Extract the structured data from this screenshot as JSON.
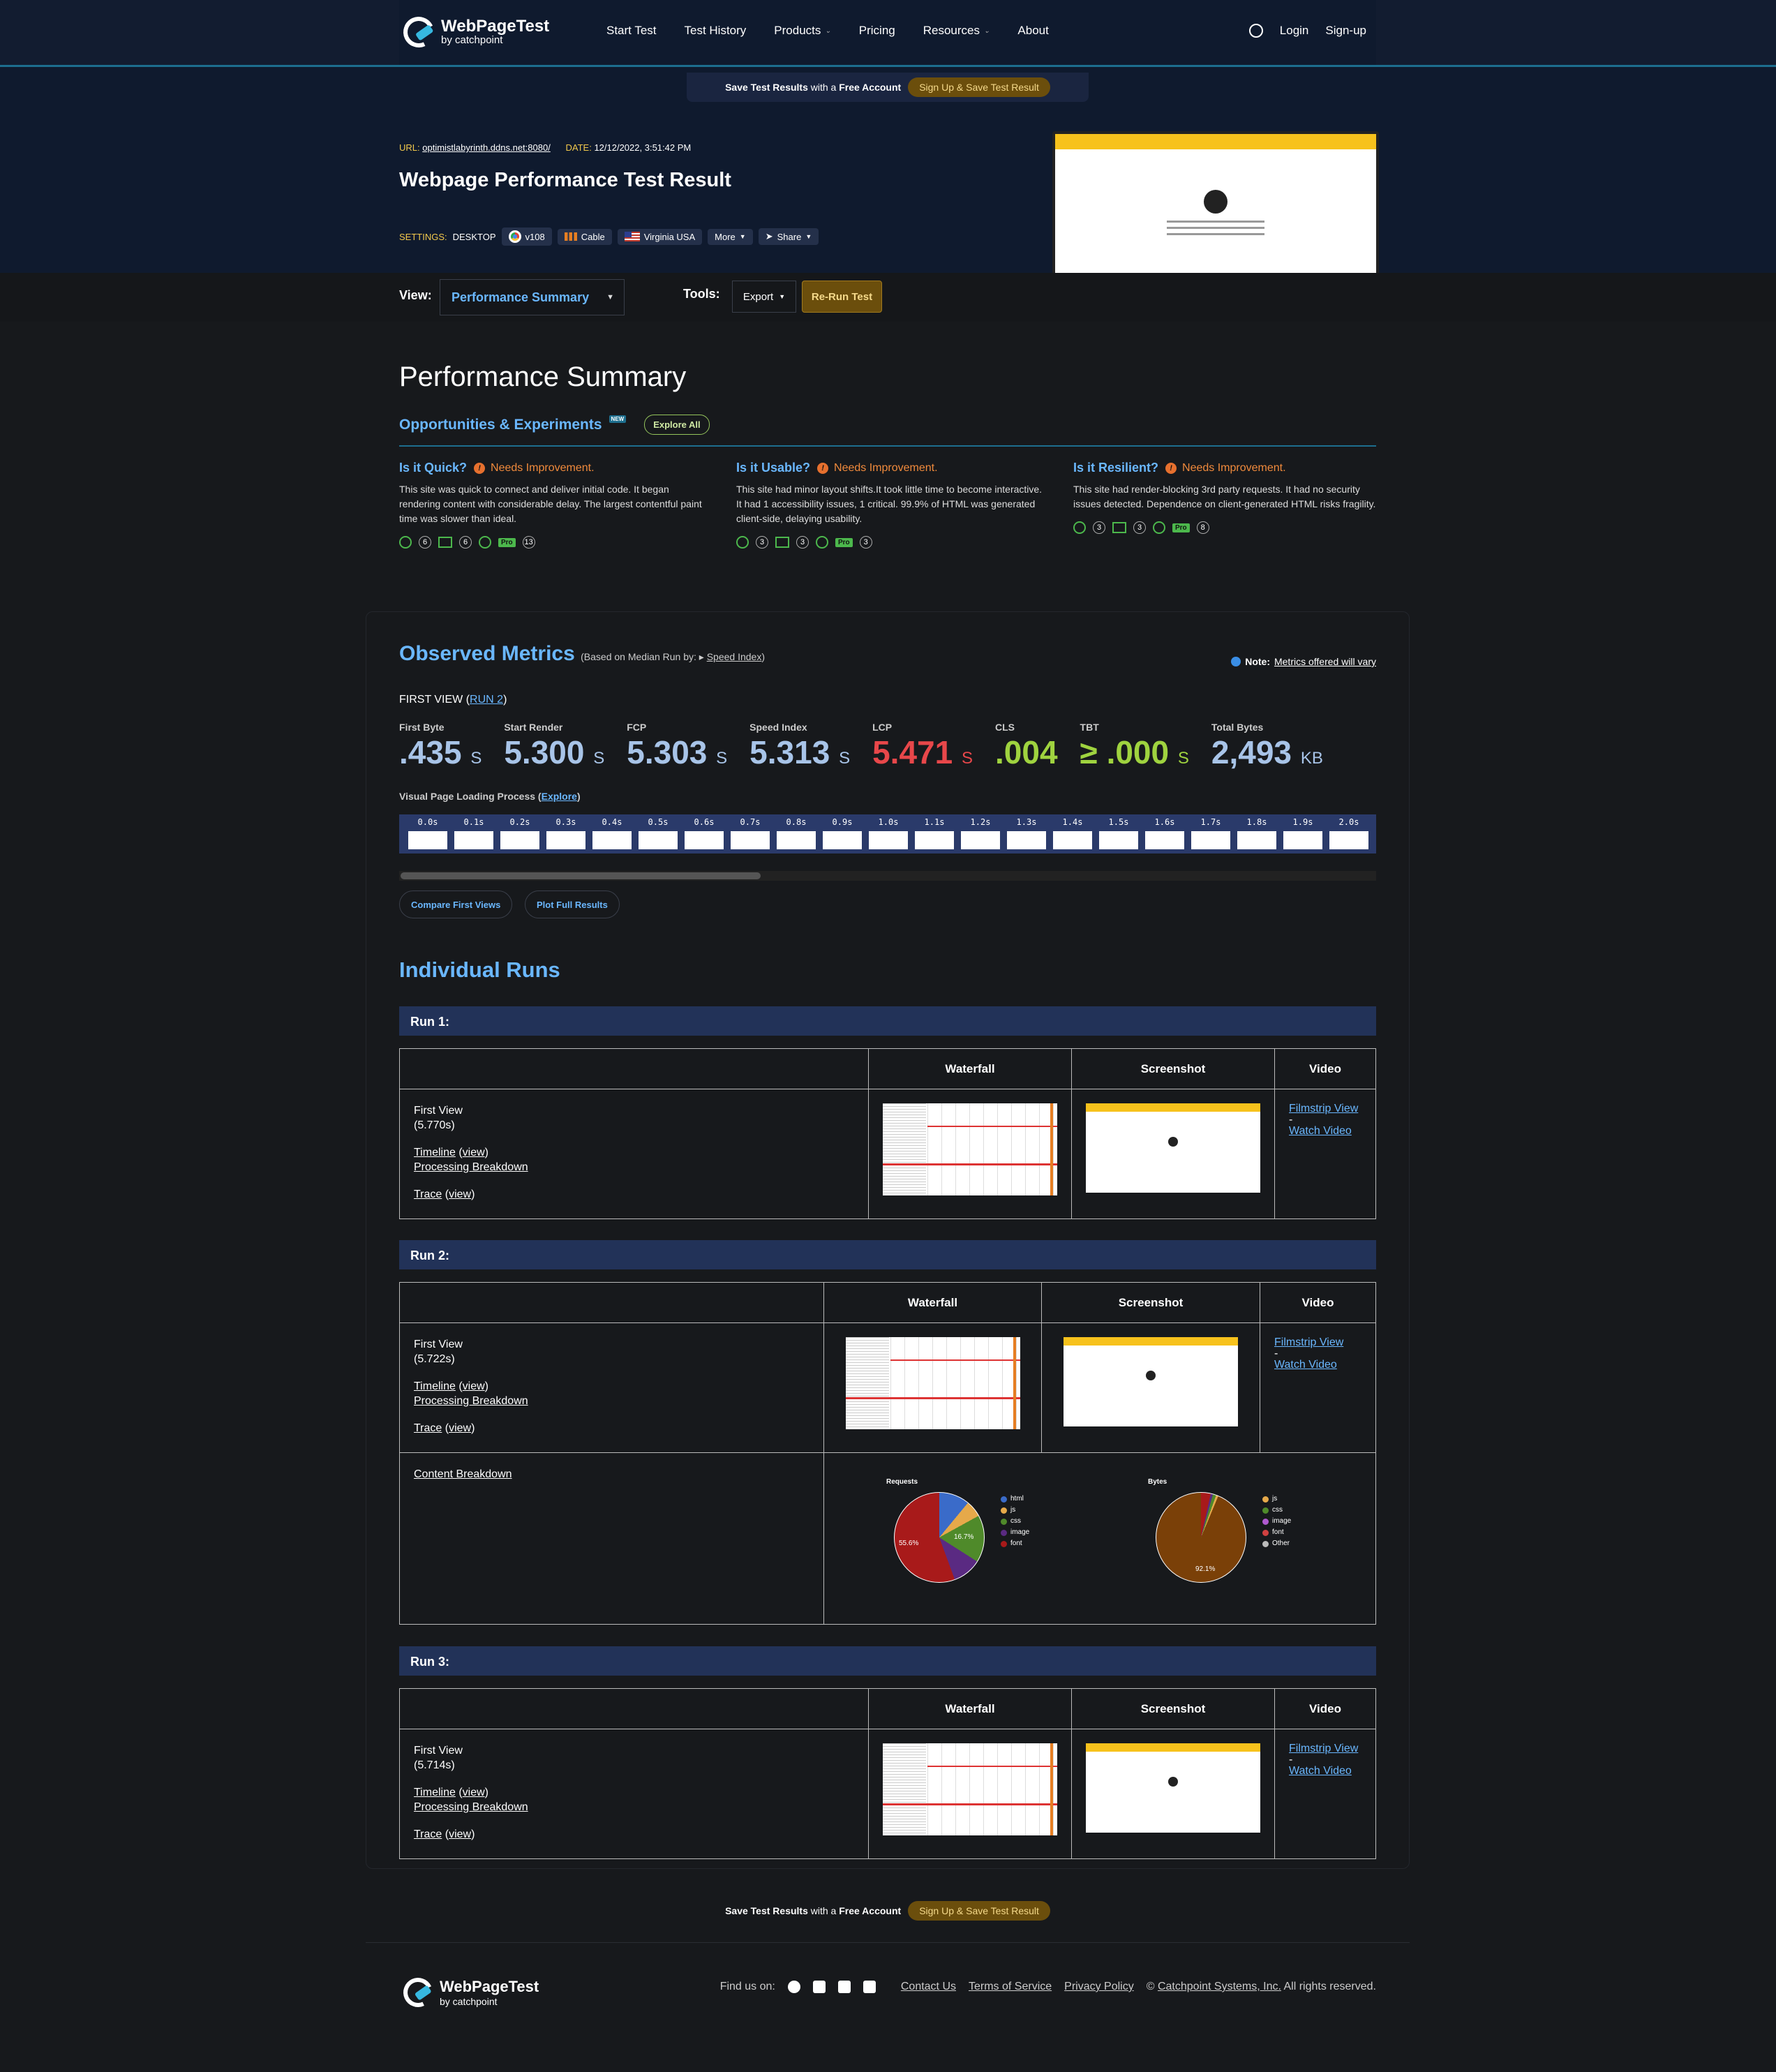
{
  "header": {
    "brand": "WebPageTest",
    "brand_sub": "by catchpoint",
    "nav": [
      {
        "label": "Start Test"
      },
      {
        "label": "Test History"
      },
      {
        "label": "Products"
      },
      {
        "label": "Pricing"
      },
      {
        "label": "Resources"
      },
      {
        "label": "About"
      }
    ],
    "login": "Login",
    "signup": "Sign-up"
  },
  "savebar": {
    "bold": "Save Test Results",
    "mid": "with a",
    "bold2": "Free Account",
    "button": "Sign Up & Save Test Result"
  },
  "test": {
    "url_label": "URL:",
    "url": "optimistlabyrinth.ddns.net:8080/",
    "date_label": "DATE:",
    "date": "12/12/2022, 3:51:42 PM",
    "title": "Webpage Performance Test Result",
    "settings_label": "SETTINGS:",
    "device": "DESKTOP",
    "browser": "v108",
    "connection": "Cable",
    "location": "Virginia USA",
    "more": "More",
    "share": "Share"
  },
  "view": {
    "label": "View:",
    "selected": "Performance Summary",
    "tools_label": "Tools:",
    "export": "Export",
    "rerun": "Re-Run Test"
  },
  "summary": {
    "title": "Performance Summary",
    "opps_title": "Opportunities & Experiments",
    "new_badge": "NEW",
    "explore_all": "Explore All",
    "columns": [
      {
        "q": "Is it Quick?",
        "status": "Needs Improvement.",
        "text": "This site was quick to connect and deliver initial code. It began rendering content with considerable delay. The largest contentful paint time was slower than ideal.",
        "c1": "6",
        "c2": "6",
        "pro": "Pro",
        "c3": "13"
      },
      {
        "q": "Is it Usable?",
        "status": "Needs Improvement.",
        "text": "This site had minor layout shifts.It took little time to become interactive. It had 1 accessibility issues, 1 critical. 99.9% of HTML was generated client-side, delaying usability.",
        "c1": "3",
        "c2": "3",
        "pro": "Pro",
        "c3": "3"
      },
      {
        "q": "Is it Resilient?",
        "status": "Needs Improvement.",
        "text": "This site had render-blocking 3rd party requests. It had no security issues detected. Dependence on client-generated HTML risks fragility.",
        "c1": "3",
        "c2": "3",
        "pro": "Pro",
        "c3": "8"
      }
    ]
  },
  "observed": {
    "title": "Observed Metrics",
    "sub": "(Based on Median Run by:",
    "sub_link": "Speed Index",
    "sub_end": ")",
    "note_bold": "Note:",
    "note": "Metrics offered will vary",
    "first_view": "FIRST VIEW (",
    "run_link": "RUN 2",
    "first_view_end": ")",
    "metrics": [
      {
        "label": "First Byte",
        "value": ".435",
        "unit": "S",
        "color": "#a8c4e8"
      },
      {
        "label": "Start Render",
        "value": "5.300",
        "unit": "S",
        "color": "#a8c4e8"
      },
      {
        "label": "FCP",
        "value": "5.303",
        "unit": "S",
        "color": "#a8c4e8"
      },
      {
        "label": "Speed Index",
        "value": "5.313",
        "unit": "S",
        "color": "#a8c4e8"
      },
      {
        "label": "LCP",
        "value": "5.471",
        "unit": "S",
        "color": "#e8474a"
      },
      {
        "label": "CLS",
        "value": ".004",
        "unit": "",
        "color": "#9fd33f"
      },
      {
        "label": "TBT",
        "value": "≥ .000",
        "unit": "S",
        "color": "#9fd33f"
      },
      {
        "label": "Total Bytes",
        "value": "2,493",
        "unit": "KB",
        "color": "#a8c4e8"
      }
    ],
    "vplp": "Visual Page Loading Process",
    "vplp_link": "Explore",
    "frames": [
      "0.0s",
      "0.1s",
      "0.2s",
      "0.3s",
      "0.4s",
      "0.5s",
      "0.6s",
      "0.7s",
      "0.8s",
      "0.9s",
      "1.0s",
      "1.1s",
      "1.2s",
      "1.3s",
      "1.4s",
      "1.5s",
      "1.6s",
      "1.7s",
      "1.8s",
      "1.9s",
      "2.0s"
    ],
    "compare": "Compare First Views",
    "plot": "Plot Full Results"
  },
  "runs": {
    "title": "Individual Runs",
    "headers": {
      "waterfall": "Waterfall",
      "screenshot": "Screenshot",
      "video": "Video"
    },
    "items": [
      {
        "label": "Run 1:",
        "fv": "First View",
        "time": "(5.770s)"
      },
      {
        "label": "Run 2:",
        "fv": "First View",
        "time": "(5.722s)"
      },
      {
        "label": "Run 3:",
        "fv": "First View",
        "time": "(5.714s)"
      }
    ],
    "timeline": "Timeline",
    "view": "view",
    "processing": "Processing Breakdown",
    "trace": "Trace",
    "filmstrip": "Filmstrip View",
    "dash": "-",
    "watch": "Watch Video",
    "content_breakdown": "Content Breakdown",
    "pie_requests": {
      "title": "Requests",
      "legend": [
        "html",
        "js",
        "css",
        "image",
        "font"
      ],
      "labels": [
        "55.6%",
        "16.7%"
      ]
    },
    "pie_bytes": {
      "title": "Bytes",
      "legend": [
        "js",
        "css",
        "image",
        "font",
        "Other"
      ],
      "labels": [
        "92.1%"
      ]
    }
  },
  "footer": {
    "brand": "WebPageTest",
    "brand_sub": "by catchpoint",
    "find": "Find us on:",
    "contact": "Contact Us",
    "tos": "Terms of Service",
    "privacy": "Privacy Policy",
    "copy": "©",
    "company": "Catchpoint Systems, Inc.",
    "rights": "All rights reserved."
  }
}
